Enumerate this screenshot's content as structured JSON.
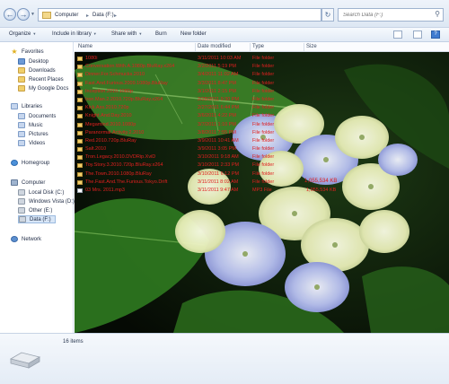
{
  "address_bar": {
    "path": [
      "Computer",
      "Data (F:)"
    ],
    "separator": "▸",
    "search_placeholder": "Search Data (F:)"
  },
  "command_bar": {
    "organize": "Organize",
    "include_in_library": "Include in library",
    "share_with": "Share with",
    "burn": "Burn",
    "new_folder": "New folder"
  },
  "sidebar": {
    "favorites_header": "Favorites",
    "favorites": [
      "Desktop",
      "Downloads",
      "Recent Places",
      "My Google Docs"
    ],
    "libraries_header": "Libraries",
    "libraries": [
      "Documents",
      "Music",
      "Pictures",
      "Videos"
    ],
    "homegroup": "Homegroup",
    "computer_header": "Computer",
    "drives": [
      "Local Disk (C:)",
      "Windows Vista (D:)",
      "Other (E:)",
      "Data (F:)"
    ],
    "network": "Network"
  },
  "columns": {
    "name": "Name",
    "date_modified": "Date modified",
    "type": "Type",
    "size": "Size"
  },
  "files": [
    {
      "name": "1080i",
      "date": "3/11/2011 10:03 AM",
      "type": "File folder",
      "size": ""
    },
    {
      "name": "Conversation.With.A.1080p.BluRay.x264",
      "date": "3/2/2011 5:19 PM",
      "type": "File folder",
      "size": ""
    },
    {
      "name": "Dinner.For.Schmucks.2010",
      "date": "3/4/2011 11:02 AM",
      "type": "File folder",
      "size": ""
    },
    {
      "name": "Fast.And.Furious.2009.1080p.BluRay",
      "date": "3/3/2011 8:47 PM",
      "type": "File folder",
      "size": ""
    },
    {
      "name": "Inception.2010.1080p",
      "date": "3/1/2011 2:15 PM",
      "type": "File folder",
      "size": ""
    },
    {
      "name": "Iron.Man.2.2010.720p.BluRay.x264",
      "date": "2/28/2011 9:30 PM",
      "type": "File folder",
      "size": ""
    },
    {
      "name": "Kick.Ass.2010.720p",
      "date": "2/27/2011 6:44 PM",
      "type": "File folder",
      "size": ""
    },
    {
      "name": "Knight.And.Day.2010",
      "date": "3/6/2011 4:22 PM",
      "type": "File folder",
      "size": ""
    },
    {
      "name": "Megamind.2010.1080p",
      "date": "3/7/2011 1:10 PM",
      "type": "File folder",
      "size": ""
    },
    {
      "name": "Paranormal.Activity.2.2010",
      "date": "3/8/2011 7:55 PM",
      "type": "File folder",
      "size": ""
    },
    {
      "name": "Red.2010.720p.BluRay",
      "date": "3/9/2011 10:41 AM",
      "type": "File folder",
      "size": ""
    },
    {
      "name": "Salt.2010",
      "date": "3/9/2011 3:05 PM",
      "type": "File folder",
      "size": ""
    },
    {
      "name": "Tron.Legacy.2010.DVDRip.XviD",
      "date": "3/10/2011 9:18 AM",
      "type": "File folder",
      "size": ""
    },
    {
      "name": "Toy.Story.3.2010.720p.BluRay.x264",
      "date": "3/10/2011 2:33 PM",
      "type": "File folder",
      "size": ""
    },
    {
      "name": "The.Town.2010.1080p.BluRay",
      "date": "3/10/2011 6:12 PM",
      "type": "File folder",
      "size": ""
    },
    {
      "name": "The.Fast.And.The.Furious.Tokyo.Drift",
      "date": "3/11/2011 8:02 AM",
      "type": "File folder",
      "size": ""
    },
    {
      "name": "03 Mrs. 2011.mp3",
      "date": "3/11/2011 9:47 AM",
      "type": "MP3 File",
      "size": "1,055,534 KB"
    }
  ],
  "status": {
    "items_count": "16 items"
  },
  "colors": {
    "file_text": "#e02020",
    "selected_bg": "#d8e6f7"
  }
}
